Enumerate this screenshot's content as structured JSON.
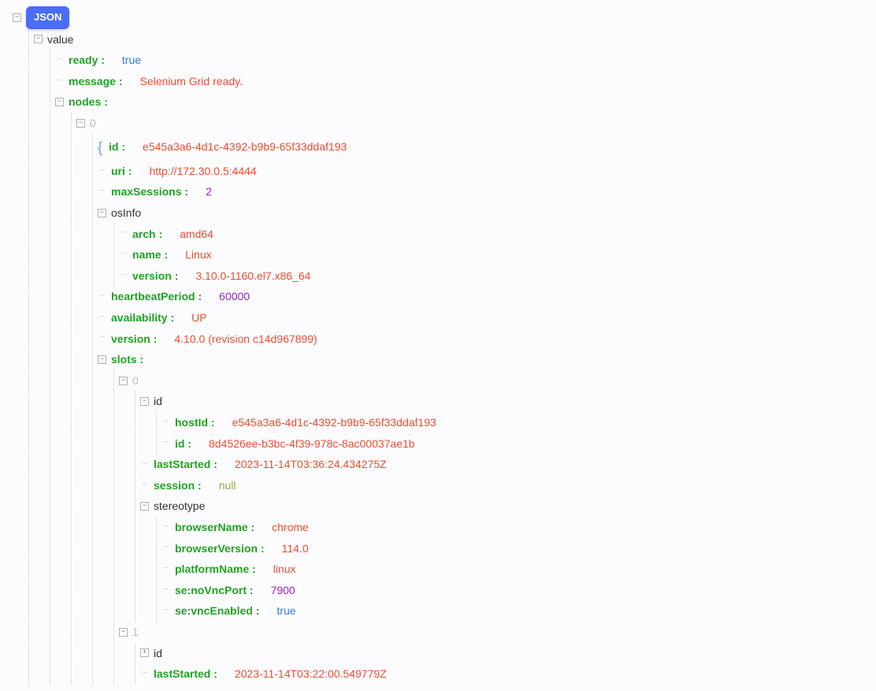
{
  "badge": "JSON",
  "tree": {
    "value": {
      "ready": {
        "type": "bool",
        "value": "true"
      },
      "message": {
        "type": "str",
        "value": "Selenium Grid ready."
      },
      "nodes": {
        "0": {
          "id": {
            "type": "str",
            "value": "e545a3a6-4d1c-4392-b9b9-65f33ddaf193"
          },
          "uri": {
            "type": "str",
            "value": "http://172.30.0.5:4444"
          },
          "maxSessions": {
            "type": "num",
            "value": "2"
          },
          "osInfo": {
            "arch": {
              "type": "str",
              "value": "amd64"
            },
            "name": {
              "type": "str",
              "value": "Linux"
            },
            "version": {
              "type": "str",
              "value": "3.10.0-1160.el7.x86_64"
            }
          },
          "heartbeatPeriod": {
            "type": "num",
            "value": "60000"
          },
          "availability": {
            "type": "str",
            "value": "UP"
          },
          "version": {
            "type": "str",
            "value": "4.10.0 (revision c14d967899)"
          },
          "slots": {
            "0": {
              "id": {
                "hostId": {
                  "type": "str",
                  "value": "e545a3a6-4d1c-4392-b9b9-65f33ddaf193"
                },
                "id": {
                  "type": "str",
                  "value": "8d4526ee-b3bc-4f39-978c-8ac00037ae1b"
                }
              },
              "lastStarted": {
                "type": "str",
                "value": "2023-11-14T03:36:24.434275Z"
              },
              "session": {
                "type": "null",
                "value": "null"
              },
              "stereotype": {
                "browserName": {
                  "type": "str",
                  "value": "chrome"
                },
                "browserVersion": {
                  "type": "str",
                  "value": "114.0"
                },
                "platformName": {
                  "type": "str",
                  "value": "linux"
                },
                "se:noVncPort": {
                  "type": "num",
                  "value": "7900"
                },
                "se:vncEnabled": {
                  "type": "bool",
                  "value": "true"
                }
              }
            },
            "1": {
              "id_collapsed": "id",
              "lastStarted": {
                "type": "str",
                "value": "2023-11-14T03:22:00.549779Z"
              }
            }
          }
        }
      }
    }
  },
  "labels": {
    "value": "value",
    "ready": "ready",
    "message": "message",
    "nodes": "nodes",
    "idx0": "0",
    "id": "id",
    "uri": "uri",
    "maxSessions": "maxSessions",
    "osInfo": "osInfo",
    "arch": "arch",
    "name": "name",
    "version": "version",
    "heartbeatPeriod": "heartbeatPeriod",
    "availability": "availability",
    "slots": "slots",
    "hostId": "hostId",
    "lastStarted": "lastStarted",
    "session": "session",
    "stereotype": "stereotype",
    "browserName": "browserName",
    "browserVersion": "browserVersion",
    "platformName": "platformName",
    "seNoVncPort": "se:noVncPort",
    "seVncEnabled": "se:vncEnabled",
    "idx1": "1"
  }
}
